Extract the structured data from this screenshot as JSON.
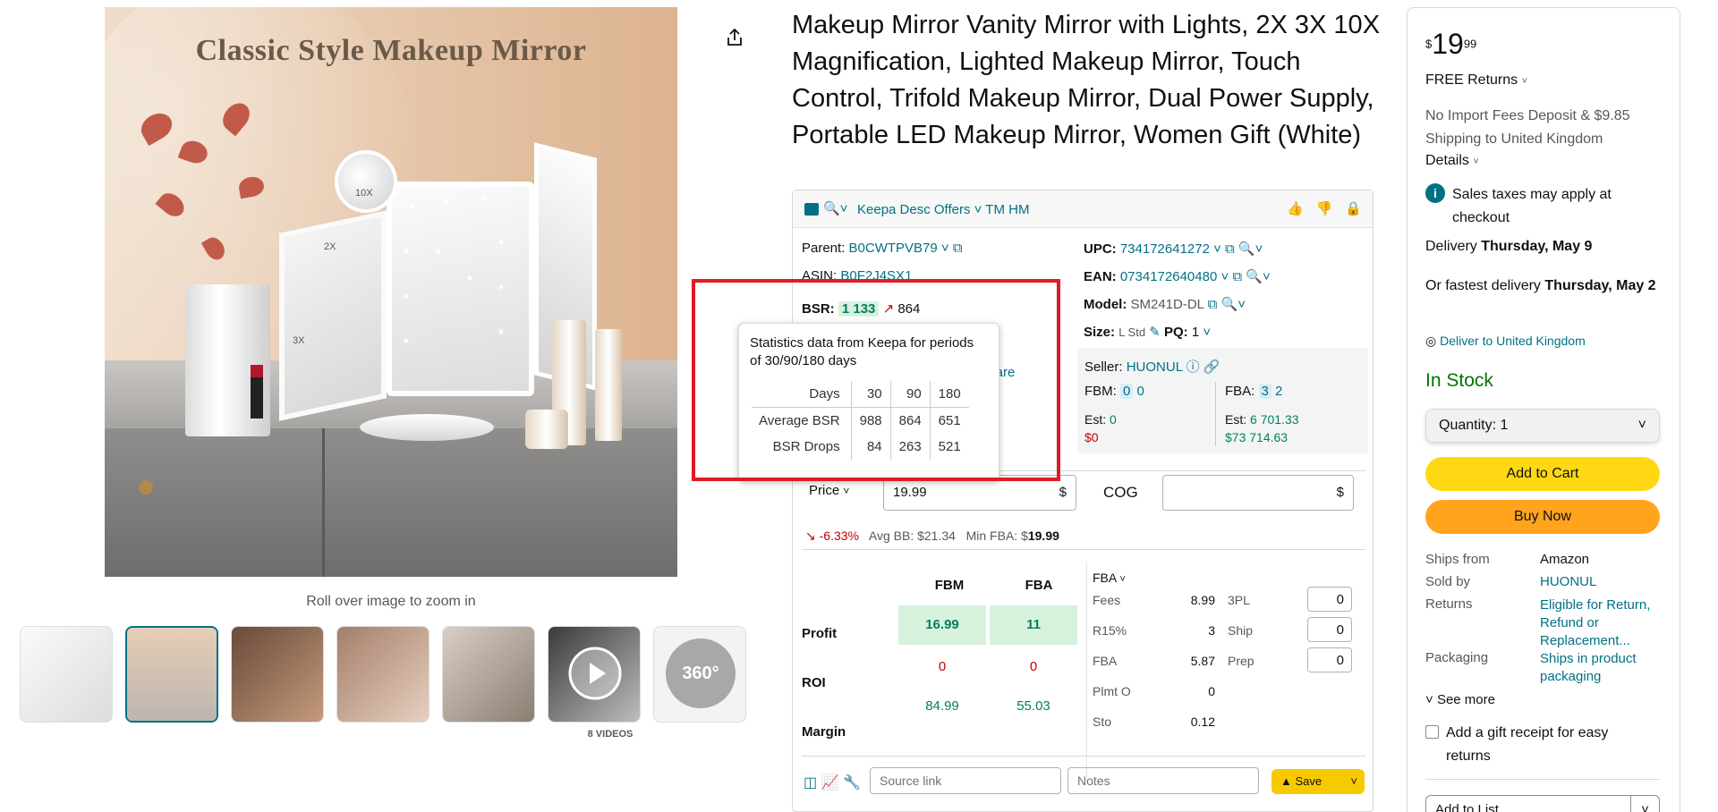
{
  "gallery": {
    "image_title": "Classic Style Makeup Mirror",
    "zoom_caption": "Roll over image to zoom in",
    "videos_label": "8 VIDEOS",
    "magnifications": [
      "10X",
      "2X",
      "3X"
    ],
    "thumb_360": "360°"
  },
  "product": {
    "title": "Makeup Mirror Vanity Mirror with Lights, 2X 3X 10X Magnification, Lighted Makeup Mirror, Touch Control, Trifold Makeup Mirror, Dual Power Supply, Portable LED Makeup Mirror, Women Gift (White)"
  },
  "keepa": {
    "header_label": "Keepa Desc Offers",
    "header_tag": "TM HM",
    "parent_label": "Parent:",
    "parent_value": "B0CWTPVB79",
    "asin_label": "ASIN:",
    "asin_value": "B0F2J4SX1",
    "bsr_label": "BSR:",
    "bsr_value": "1 133",
    "bsr_trend": "864",
    "category_partial": "al Care",
    "upc_label": "UPC:",
    "upc_value": "734172641272",
    "ean_label": "EAN:",
    "ean_value": "0734172640480",
    "model_label": "Model:",
    "model_value": "SM241D-DL",
    "size_label": "Size:",
    "size_value": "L Std",
    "pq_label": "PQ:",
    "pq_value": "1",
    "seller_label": "Seller:",
    "seller_value": "HUONUL",
    "fbm_label": "FBM:",
    "fbm_v1": "0",
    "fbm_v2": "0",
    "fba_label": "FBA:",
    "fba_v1": "3",
    "fba_v2": "2",
    "est_label": "Est:",
    "est_fbm_units": "0",
    "est_fbm_value": "$0",
    "est_fba_units": "6 701.33",
    "est_fba_value": "$73 714.63",
    "price_label": "Price",
    "price_value": "19.99",
    "currency": "$",
    "cog_label": "COG",
    "cog_value": "",
    "change_pct": "-6.33%",
    "avg_bb": "Avg BB: $21.34",
    "min_fba_label": "Min FBA: $",
    "min_fba_value": "19.99",
    "calc": {
      "col_fbm": "FBM",
      "col_fba": "FBA",
      "profit_label": "Profit",
      "roi_label": "ROI",
      "margin_label": "Margin",
      "profit_fbm": "16.99",
      "profit_fba": "11",
      "roi_fbm": "0",
      "roi_fba": "0",
      "margin_fbm": "84.99",
      "margin_fba": "55.03",
      "fees_mode": "FBA",
      "fee_rows": [
        {
          "label": "Fees",
          "value": "8.99"
        },
        {
          "label": "R15%",
          "value": "3"
        },
        {
          "label": "FBA",
          "value": "5.87"
        },
        {
          "label": "Plmt O",
          "value": "0"
        },
        {
          "label": "Sto",
          "value": "0.12"
        }
      ],
      "extra_rows": [
        {
          "label": "3PL",
          "value": "0"
        },
        {
          "label": "Ship",
          "value": "0"
        },
        {
          "label": "Prep",
          "value": "0"
        }
      ]
    },
    "source_placeholder": "Source link",
    "notes_placeholder": "Notes",
    "save_label": "Save"
  },
  "tooltip": {
    "header": "Statistics data from Keepa for periods of 30/90/180 days",
    "columns": [
      "Days",
      "30",
      "90",
      "180"
    ],
    "rows": [
      {
        "label": "Average BSR",
        "values": [
          "988",
          "864",
          "651"
        ]
      },
      {
        "label": "BSR Drops",
        "values": [
          "84",
          "263",
          "521"
        ]
      }
    ]
  },
  "buybox": {
    "price_symbol": "$",
    "price_whole": "19",
    "price_fraction": "99",
    "free_returns": "FREE Returns",
    "import_fees": "No Import Fees Deposit & $9.85 Shipping to United Kingdom",
    "details": "Details",
    "tax_note": "Sales taxes may apply at checkout",
    "delivery_prefix": "Delivery",
    "delivery_date": "Thursday, May 9",
    "fastest_prefix": "Or fastest delivery",
    "fastest_date": "Thursday, May 2",
    "deliver_to": "Deliver to United Kingdom",
    "stock": "In Stock",
    "quantity": "Quantity: 1",
    "add_to_cart": "Add to Cart",
    "buy_now": "Buy Now",
    "ships_from_label": "Ships from",
    "ships_from_value": "Amazon",
    "sold_by_label": "Sold by",
    "sold_by_value": "HUONUL",
    "returns_label": "Returns",
    "returns_value": "Eligible for Return, Refund or Replacement...",
    "packaging_label": "Packaging",
    "packaging_value": "Ships in product packaging",
    "see_more": "See more",
    "gift_receipt": "Add a gift receipt for easy returns",
    "add_to_list": "Add to List"
  },
  "colors": {
    "link": "#007185",
    "green": "#067d62",
    "red": "#c40000",
    "highlight_border": "#e01b24",
    "cart_button": "#ffd814",
    "buy_button": "#ffa41c"
  }
}
